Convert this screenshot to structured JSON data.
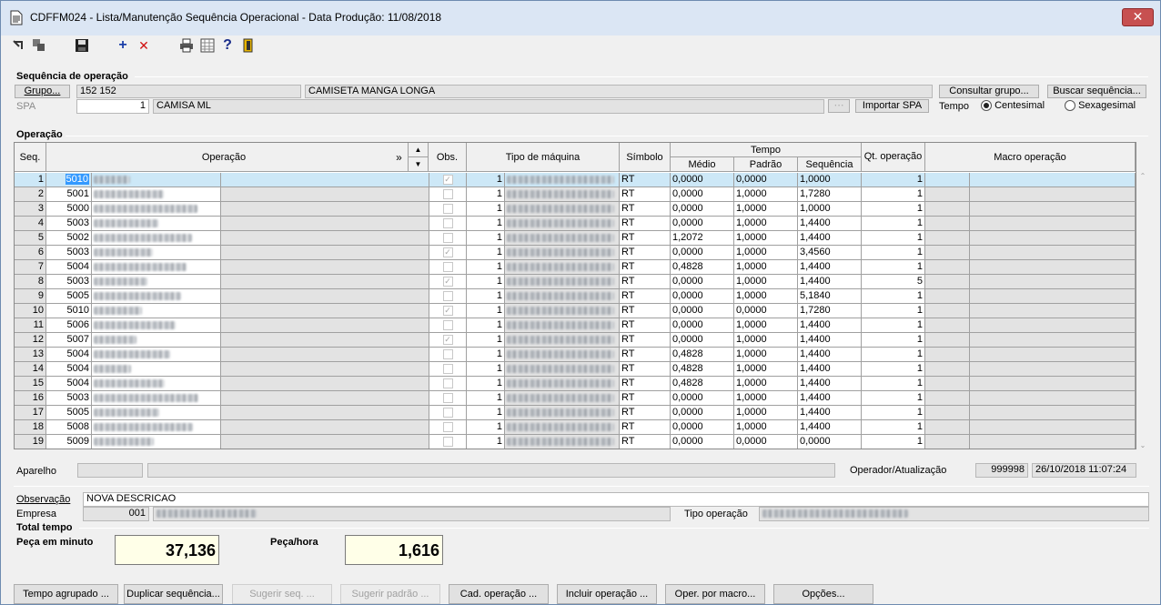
{
  "window": {
    "title": "CDFFM024 - Lista/Manutenção Sequência Operacional - Data Produção: 11/08/2018",
    "close_glyph": "✕"
  },
  "toolbar": {
    "icons": [
      "back-icon",
      "copy-icon",
      "save-icon",
      "add-icon",
      "delete-icon",
      "print-icon",
      "grid-icon",
      "help-icon",
      "exit-icon"
    ],
    "add_glyph": "+",
    "delete_glyph": "✕",
    "help_glyph": "?"
  },
  "sequencia": {
    "legend": "Sequência de operação",
    "grupo_button": "Grupo...",
    "grupo_code": "152 152",
    "grupo_desc": "CAMISETA MANGA LONGA",
    "consultar_button": "Consultar grupo...",
    "buscar_button": "Buscar sequência...",
    "spa_label": "SPA",
    "spa_value": "1",
    "spa_desc": "CAMISA ML",
    "importar_button": "Importar SPA",
    "tempo_label": "Tempo",
    "centesimal_label": "Centesimal",
    "sexagesimal_label": "Sexagesimal",
    "tempo_selected": "Centesimal"
  },
  "operacao": {
    "legend": "Operação",
    "headers": {
      "seq": "Seq.",
      "operacao": "Operação",
      "expand": "»",
      "up": "▲",
      "down": "▼",
      "obs": "Obs.",
      "tipo_maquina": "Tipo de máquina",
      "simbolo": "Símbolo",
      "tempo": "Tempo",
      "medio": "Médio",
      "padrao": "Padrão",
      "sequencia": "Sequência",
      "qt_operacao": "Qt. operação",
      "macro": "Macro operação"
    },
    "rows": [
      {
        "seq": "1",
        "code": "5010",
        "obs": true,
        "tipo": "1",
        "simbolo": "RT",
        "medio": "0,0000",
        "padrao": "0,0000",
        "sequencia": "1,0000",
        "qt": "1"
      },
      {
        "seq": "2",
        "code": "5001",
        "obs": false,
        "tipo": "1",
        "simbolo": "RT",
        "medio": "0,0000",
        "padrao": "1,0000",
        "sequencia": "1,7280",
        "qt": "1"
      },
      {
        "seq": "3",
        "code": "5000",
        "obs": false,
        "tipo": "1",
        "simbolo": "RT",
        "medio": "0,0000",
        "padrao": "1,0000",
        "sequencia": "1,0000",
        "qt": "1"
      },
      {
        "seq": "4",
        "code": "5003",
        "obs": false,
        "tipo": "1",
        "simbolo": "RT",
        "medio": "0,0000",
        "padrao": "1,0000",
        "sequencia": "1,4400",
        "qt": "1"
      },
      {
        "seq": "5",
        "code": "5002",
        "obs": false,
        "tipo": "1",
        "simbolo": "RT",
        "medio": "1,2072",
        "padrao": "1,0000",
        "sequencia": "1,4400",
        "qt": "1"
      },
      {
        "seq": "6",
        "code": "5003",
        "obs": true,
        "tipo": "1",
        "simbolo": "RT",
        "medio": "0,0000",
        "padrao": "1,0000",
        "sequencia": "3,4560",
        "qt": "1"
      },
      {
        "seq": "7",
        "code": "5004",
        "obs": false,
        "tipo": "1",
        "simbolo": "RT",
        "medio": "0,4828",
        "padrao": "1,0000",
        "sequencia": "1,4400",
        "qt": "1"
      },
      {
        "seq": "8",
        "code": "5003",
        "obs": true,
        "tipo": "1",
        "simbolo": "RT",
        "medio": "0,0000",
        "padrao": "1,0000",
        "sequencia": "1,4400",
        "qt": "5"
      },
      {
        "seq": "9",
        "code": "5005",
        "obs": false,
        "tipo": "1",
        "simbolo": "RT",
        "medio": "0,0000",
        "padrao": "1,0000",
        "sequencia": "5,1840",
        "qt": "1"
      },
      {
        "seq": "10",
        "code": "5010",
        "obs": true,
        "tipo": "1",
        "simbolo": "RT",
        "medio": "0,0000",
        "padrao": "0,0000",
        "sequencia": "1,7280",
        "qt": "1"
      },
      {
        "seq": "11",
        "code": "5006",
        "obs": false,
        "tipo": "1",
        "simbolo": "RT",
        "medio": "0,0000",
        "padrao": "1,0000",
        "sequencia": "1,4400",
        "qt": "1"
      },
      {
        "seq": "12",
        "code": "5007",
        "obs": true,
        "tipo": "1",
        "simbolo": "RT",
        "medio": "0,0000",
        "padrao": "1,0000",
        "sequencia": "1,4400",
        "qt": "1"
      },
      {
        "seq": "13",
        "code": "5004",
        "obs": false,
        "tipo": "1",
        "simbolo": "RT",
        "medio": "0,4828",
        "padrao": "1,0000",
        "sequencia": "1,4400",
        "qt": "1"
      },
      {
        "seq": "14",
        "code": "5004",
        "obs": false,
        "tipo": "1",
        "simbolo": "RT",
        "medio": "0,4828",
        "padrao": "1,0000",
        "sequencia": "1,4400",
        "qt": "1"
      },
      {
        "seq": "15",
        "code": "5004",
        "obs": false,
        "tipo": "1",
        "simbolo": "RT",
        "medio": "0,4828",
        "padrao": "1,0000",
        "sequencia": "1,4400",
        "qt": "1"
      },
      {
        "seq": "16",
        "code": "5003",
        "obs": false,
        "tipo": "1",
        "simbolo": "RT",
        "medio": "0,0000",
        "padrao": "1,0000",
        "sequencia": "1,4400",
        "qt": "1"
      },
      {
        "seq": "17",
        "code": "5005",
        "obs": false,
        "tipo": "1",
        "simbolo": "RT",
        "medio": "0,0000",
        "padrao": "1,0000",
        "sequencia": "1,4400",
        "qt": "1"
      },
      {
        "seq": "18",
        "code": "5008",
        "obs": false,
        "tipo": "1",
        "simbolo": "RT",
        "medio": "0,0000",
        "padrao": "1,0000",
        "sequencia": "1,4400",
        "qt": "1"
      },
      {
        "seq": "19",
        "code": "5009",
        "obs": false,
        "tipo": "1",
        "simbolo": "RT",
        "medio": "0,0000",
        "padrao": "0,0000",
        "sequencia": "0,0000",
        "qt": "1"
      }
    ]
  },
  "status": {
    "aparelho_label": "Aparelho",
    "operador_label": "Operador/Atualização",
    "operador_code": "999998",
    "atualizacao": "26/10/2018 11:07:24"
  },
  "details": {
    "observacao_label": "Observação",
    "observacao_value": "NOVA DESCRICAO",
    "empresa_label": "Empresa",
    "empresa_code": "001",
    "tipo_operacao_label": "Tipo operação"
  },
  "total": {
    "legend": "Total tempo",
    "peca_minuto_label": "Peça em minuto",
    "peca_minuto_value": "37,136",
    "peca_hora_label": "Peça/hora",
    "peca_hora_value": "1,616"
  },
  "buttons": {
    "tempo_agrupado": "Tempo agrupado ...",
    "duplicar": "Duplicar sequência...",
    "sugerir_seq": "Sugerir seq. ...",
    "sugerir_padrao": "Sugerir padrão ...",
    "cad_operacao": "Cad. operação ...",
    "incluir_operacao": "Incluir operação ...",
    "oper_macro": "Oper. por macro...",
    "opcoes": "Opções..."
  }
}
